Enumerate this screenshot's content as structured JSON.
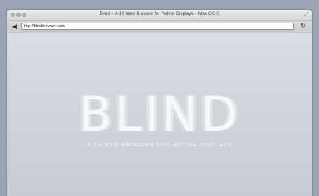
{
  "window": {
    "title": "Blind – A 1X Web Browser for Retina Displays – Mac OS X"
  },
  "toolbar": {
    "url": "http://blindbrowser.com/"
  },
  "icons": {
    "back": "back-arrow-icon",
    "reload": "reload-icon",
    "resize": "fullscreen-icon"
  },
  "page": {
    "logo": "BLIND",
    "tagline": "A 1X WEB BROWSER FOR RETINA DISPLAYS"
  },
  "colors": {
    "desktop": "#9aa4b4",
    "content_bg": "#d2d6dc",
    "logo": "#f7f8fa"
  }
}
